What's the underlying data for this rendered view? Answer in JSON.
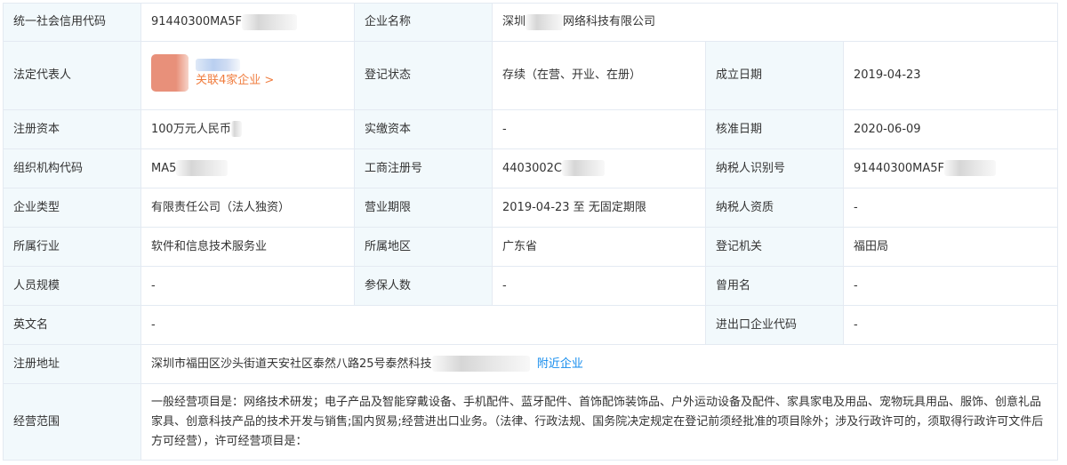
{
  "rows": {
    "credit_code": {
      "label": "统一社会信用代码",
      "value": "91440300MA5F"
    },
    "company_name": {
      "label": "企业名称",
      "prefix": "深圳",
      "suffix": "网络科技有限公司"
    },
    "legal_rep": {
      "label": "法定代表人",
      "related": "关联4家企业 >"
    },
    "reg_status": {
      "label": "登记状态",
      "value": "存续（在营、开业、在册）"
    },
    "founded": {
      "label": "成立日期",
      "value": "2019-04-23"
    },
    "reg_capital": {
      "label": "注册资本",
      "value": "100万元人民币"
    },
    "paid_capital": {
      "label": "实缴资本",
      "value": "-"
    },
    "approval_date": {
      "label": "核准日期",
      "value": "2020-06-09"
    },
    "org_code": {
      "label": "组织机构代码",
      "value": "MA5"
    },
    "biz_reg_no": {
      "label": "工商注册号",
      "value": "4403002C"
    },
    "taxpayer_id": {
      "label": "纳税人识别号",
      "value": "91440300MA5F"
    },
    "company_type": {
      "label": "企业类型",
      "value": "有限责任公司（法人独资）"
    },
    "biz_term": {
      "label": "营业期限",
      "value": "2019-04-23 至 无固定期限"
    },
    "taxpayer_qual": {
      "label": "纳税人资质",
      "value": "-"
    },
    "industry": {
      "label": "所属行业",
      "value": "软件和信息技术服务业"
    },
    "region": {
      "label": "所属地区",
      "value": "广东省"
    },
    "reg_authority": {
      "label": "登记机关",
      "value": "福田局"
    },
    "staff_size": {
      "label": "人员规模",
      "value": "-"
    },
    "insured": {
      "label": "参保人数",
      "value": "-"
    },
    "former_name": {
      "label": "曾用名",
      "value": "-"
    },
    "english_name": {
      "label": "英文名",
      "value": "-"
    },
    "import_export": {
      "label": "进出口企业代码",
      "value": "-"
    },
    "address": {
      "label": "注册地址",
      "value": "深圳市福田区沙头街道天安社区泰然八路25号泰然科技",
      "nearby": "附近企业"
    },
    "scope": {
      "label": "经营范围",
      "value": "一般经营项目是：网络技术研发；电子产品及智能穿戴设备、手机配件、蓝牙配件、首饰配饰装饰品、户外运动设备及配件、家具家电及用品、宠物玩具用品、服饰、创意礼品家具、创意科技产品的技术开发与销售;国内贸易;经营进出口业务。（法律、行政法规、国务院决定规定在登记前须经批准的项目除外；涉及行政许可的，须取得行政许可文件后方可经营），许可经营项目是："
    }
  },
  "colors": {
    "label_bg": "#f2f9fc",
    "border": "#e4eaf2",
    "link": "#128bed",
    "related": "#f07d3f"
  }
}
